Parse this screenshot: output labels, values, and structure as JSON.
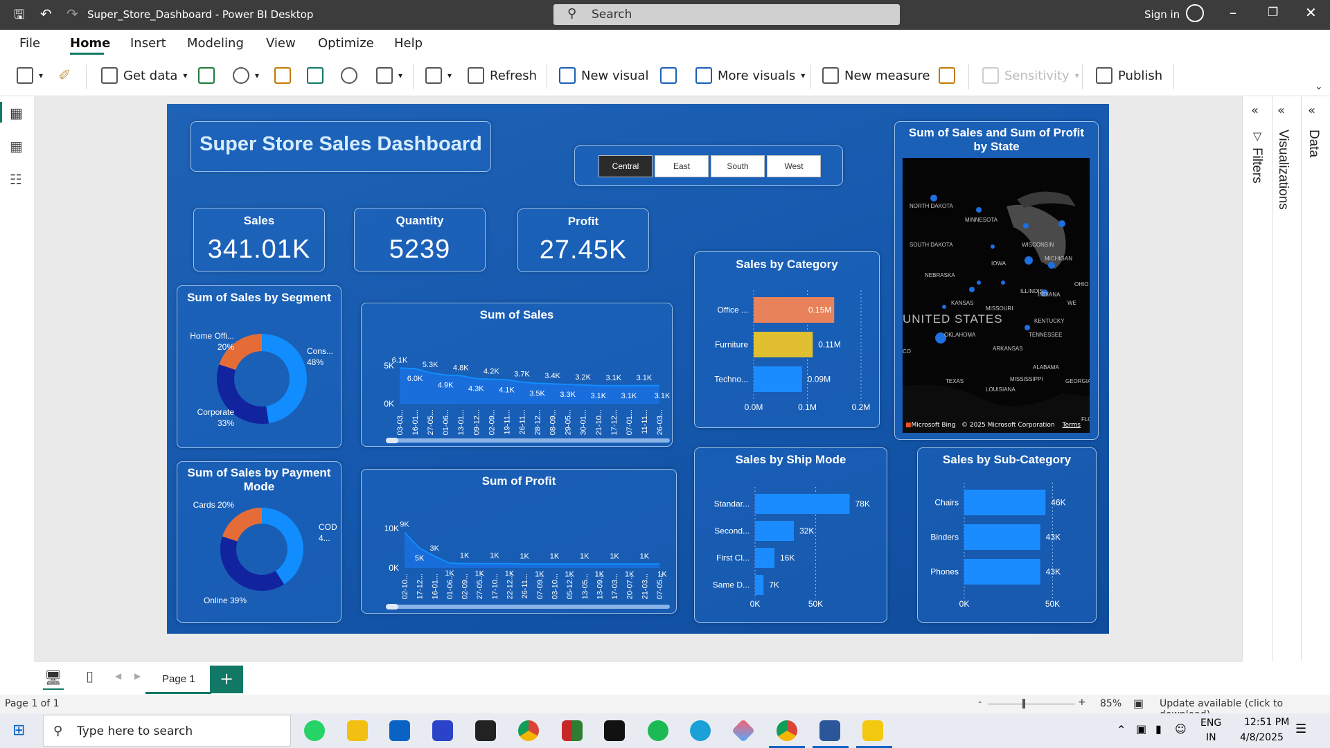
{
  "window": {
    "title": "Super_Store_Dashboard - Power BI Desktop",
    "search_placeholder": "Search",
    "sign_in": "Sign in"
  },
  "menu": [
    "File",
    "Home",
    "Insert",
    "Modeling",
    "View",
    "Optimize",
    "Help"
  ],
  "ribbon": {
    "get_data": "Get data",
    "refresh": "Refresh",
    "new_visual": "New visual",
    "more_visuals": "More visuals",
    "new_measure": "New measure",
    "sensitivity": "Sensitivity",
    "publish": "Publish"
  },
  "dashboard": {
    "title": "Super Store Sales Dashboard",
    "regions": [
      "Central",
      "East",
      "South",
      "West"
    ],
    "selected_region": "Central",
    "kpis": [
      {
        "label": "Sales",
        "value": "341.01K"
      },
      {
        "label": "Quantity",
        "value": "5239"
      },
      {
        "label": "Profit",
        "value": "27.45K"
      }
    ],
    "map": {
      "title": "Sum of Sales and Sum of Profit by State",
      "labels": [
        "NORTH DAKOTA",
        "MINNESOTA",
        "SOUTH DAKOTA",
        "WISCONSIN",
        "MICHIGAN",
        "IOWA",
        "NEBRASKA",
        "UNITED STATES",
        "ILLINOIS",
        "INDIANA",
        "OHIO",
        "KANSAS",
        "MISSOURI",
        "KENTUCKY",
        "OKLAHOMA",
        "ARKANSAS",
        "TENNESSEE",
        "TEXAS",
        "ALABAMA",
        "MISSISSIPPI",
        "LOUISIANA",
        "GEORGIA",
        "WE",
        "CO",
        "FLO"
      ],
      "attribution": "Microsoft Bing",
      "copyright": "© 2025 Microsoft Corporation",
      "terms": "Terms"
    }
  },
  "chart_data": [
    {
      "id": "segment",
      "type": "pie",
      "title": "Sum of Sales by Segment",
      "slices": [
        {
          "label": "Cons...",
          "pct_label": "48%",
          "value": 48,
          "color": "#118dff"
        },
        {
          "label": "Corporate",
          "pct_label": "33%",
          "value": 33,
          "color": "#12239e"
        },
        {
          "label": "Home Offi...",
          "pct_label": "20%",
          "value": 20,
          "color": "#e66c37"
        }
      ]
    },
    {
      "id": "payment",
      "type": "pie",
      "title": "Sum of Sales by Payment Mode",
      "slices": [
        {
          "label": "COD",
          "pct_label": "4...",
          "value": 41,
          "color": "#118dff"
        },
        {
          "label": "Online",
          "pct_label": "39%",
          "value": 39,
          "color": "#12239e"
        },
        {
          "label": "Cards",
          "pct_label": "20%",
          "value": 20,
          "color": "#e66c37"
        }
      ]
    },
    {
      "id": "sales_trend",
      "type": "area",
      "title": "Sum of Sales",
      "x": [
        "03-03...",
        "16-01...",
        "27-05...",
        "01-06...",
        "13-01...",
        "09-12...",
        "02-09...",
        "19-11...",
        "26-11...",
        "28-12...",
        "08-09...",
        "29-05...",
        "30-01...",
        "21-10...",
        "17-12...",
        "07-01...",
        "11-11...",
        "26-03..."
      ],
      "y_labels": [
        "6.1K",
        "6.0K",
        "5.3K",
        "4.9K",
        "4.8K",
        "4.3K",
        "4.2K",
        "4.1K",
        "3.7K",
        "3.5K",
        "3.4K",
        "3.3K",
        "3.2K",
        "3.1K",
        "3.1K",
        "3.1K",
        "3.1K",
        "3.1K"
      ],
      "values": [
        6100,
        6000,
        5300,
        4900,
        4800,
        4300,
        4200,
        4100,
        3700,
        3500,
        3400,
        3300,
        3200,
        3100,
        3100,
        3100,
        3100,
        3100
      ],
      "ylim": [
        0,
        6500
      ],
      "yticks": [
        "0K",
        "5K"
      ]
    },
    {
      "id": "profit_trend",
      "type": "area",
      "title": "Sum of Profit",
      "x": [
        "02-10...",
        "17-12...",
        "16-01...",
        "01-06...",
        "02-09...",
        "27-05...",
        "17-10...",
        "22-12...",
        "26-11...",
        "07-09...",
        "03-10...",
        "05-12...",
        "13-05...",
        "13-09...",
        "17-03...",
        "20-07...",
        "21-03...",
        "07-05..."
      ],
      "y_labels": [
        "9K",
        "5K",
        "3K",
        "1K",
        "1K",
        "1K",
        "1K",
        "1K",
        "1K",
        "1K",
        "1K",
        "1K",
        "1K",
        "1K",
        "1K",
        "1K",
        "1K",
        "1K"
      ],
      "values": [
        9000,
        5000,
        3000,
        1200,
        1100,
        1100,
        1100,
        1100,
        1000,
        1000,
        1000,
        1000,
        1000,
        1000,
        1000,
        1000,
        1000,
        1000
      ],
      "ylim": [
        0,
        10000
      ],
      "yticks": [
        "0K",
        "10K"
      ]
    },
    {
      "id": "category",
      "type": "bar",
      "title": "Sales by Category",
      "categories": [
        "Office ...",
        "Furniture",
        "Techno..."
      ],
      "values": [
        0.15,
        0.11,
        0.09
      ],
      "labels": [
        "0.15M",
        "0.11M",
        "0.09M"
      ],
      "colors": [
        "#e8825a",
        "#e0c030",
        "#1a8cff"
      ],
      "xticks": [
        "0.0M",
        "0.1M",
        "0.2M"
      ],
      "xlim": [
        0,
        0.2
      ]
    },
    {
      "id": "shipmode",
      "type": "bar",
      "title": "Sales by Ship Mode",
      "categories": [
        "Standar...",
        "Second...",
        "First Cl...",
        "Same D..."
      ],
      "values": [
        78,
        32,
        16,
        7
      ],
      "labels": [
        "78K",
        "32K",
        "16K",
        "7K"
      ],
      "colors": [
        "#1a8cff",
        "#1a8cff",
        "#1a8cff",
        "#1a8cff"
      ],
      "xticks": [
        "0K",
        "50K"
      ],
      "xlim": [
        0,
        100
      ]
    },
    {
      "id": "subcategory",
      "type": "bar",
      "title": "Sales by Sub-Category",
      "categories": [
        "Chairs",
        "Binders",
        "Phones"
      ],
      "values": [
        46,
        43,
        43
      ],
      "labels": [
        "46K",
        "43K",
        "43K"
      ],
      "colors": [
        "#1a8cff",
        "#1a8cff",
        "#1a8cff"
      ],
      "xticks": [
        "0K",
        "50K"
      ],
      "xlim": [
        0,
        60
      ]
    }
  ],
  "panes": {
    "filters": "Filters",
    "visualizations": "Visualizations",
    "data": "Data"
  },
  "pagebar": {
    "page_tab": "Page 1"
  },
  "status": {
    "page": "Page 1 of 1",
    "zoom": "85%",
    "update": "Update available (click to download)"
  },
  "taskbar": {
    "search": "Type here to search",
    "lang1": "ENG",
    "lang2": "IN",
    "time": "12:51 PM",
    "date": "4/8/2025"
  }
}
